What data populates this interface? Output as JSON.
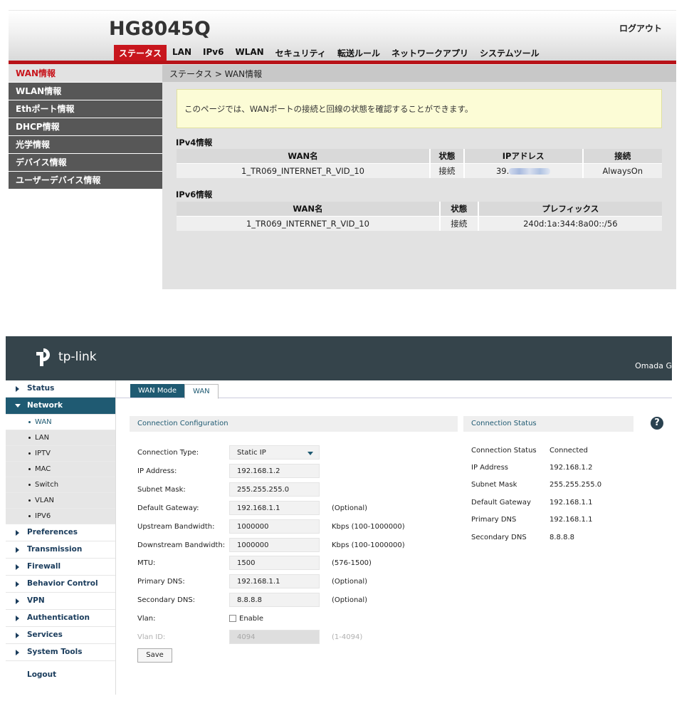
{
  "hg": {
    "model": "HG8045Q",
    "logout": "ログアウト",
    "tabs": [
      "ステータス",
      "LAN",
      "IPv6",
      "WLAN",
      "セキュリティ",
      "転送ルール",
      "ネットワークアプリ",
      "システムツール"
    ],
    "sidebar": [
      "WAN情報",
      "WLAN情報",
      "Ethポート情報",
      "DHCP情報",
      "光学情報",
      "デバイス情報",
      "ユーザーデバイス情報"
    ],
    "breadcrumb": "ステータス > WAN情報",
    "info": "このページでは、WANポートの接続と回線の状態を確認することができます。",
    "ipv4_title": "IPv4情報",
    "ipv4_headers": [
      "WAN名",
      "状態",
      "IPアドレス",
      "接続"
    ],
    "ipv4_row": {
      "wan": "1_TR069_INTERNET_R_VID_10",
      "status": "接続",
      "ip": "39.",
      "conn": "AlwaysOn"
    },
    "ipv6_title": "IPv6情報",
    "ipv6_headers": [
      "WAN名",
      "状態",
      "プレフィックス"
    ],
    "ipv6_row": {
      "wan": "1_TR069_INTERNET_R_VID_10",
      "status": "接続",
      "prefix": "240d:1a:344:8a00::/56"
    }
  },
  "tp": {
    "brand": "tp-link",
    "omada": "Omada G",
    "menu": [
      {
        "label": "Status"
      },
      {
        "label": "Network"
      },
      {
        "label": "Preferences"
      },
      {
        "label": "Transmission"
      },
      {
        "label": "Firewall"
      },
      {
        "label": "Behavior Control"
      },
      {
        "label": "VPN"
      },
      {
        "label": "Authentication"
      },
      {
        "label": "Services"
      },
      {
        "label": "System Tools"
      }
    ],
    "submenu": [
      "WAN",
      "LAN",
      "IPTV",
      "MAC",
      "Switch",
      "VLAN",
      "IPV6"
    ],
    "logout": "Logout",
    "tabs": [
      "WAN Mode",
      "WAN"
    ],
    "config_title": "Connection Configuration",
    "status_title": "Connection Status",
    "help": "?",
    "fields": {
      "connection_type": {
        "label": "Connection Type:",
        "value": "Static IP"
      },
      "ip": {
        "label": "IP Address:",
        "value": "192.168.1.2"
      },
      "mask": {
        "label": "Subnet Mask:",
        "value": "255.255.255.0"
      },
      "gateway": {
        "label": "Default Gateway:",
        "value": "192.168.1.1",
        "suffix": "(Optional)"
      },
      "up": {
        "label": "Upstream Bandwidth:",
        "value": "1000000",
        "suffix": "Kbps (100-1000000)"
      },
      "down": {
        "label": "Downstream Bandwidth:",
        "value": "1000000",
        "suffix": "Kbps (100-1000000)"
      },
      "mtu": {
        "label": "MTU:",
        "value": "1500",
        "suffix": "(576-1500)"
      },
      "dns1": {
        "label": "Primary DNS:",
        "value": "192.168.1.1",
        "suffix": "(Optional)"
      },
      "dns2": {
        "label": "Secondary DNS:",
        "value": "8.8.8.8",
        "suffix": "(Optional)"
      },
      "vlan": {
        "label": "Vlan:",
        "checkbox": "Enable"
      },
      "vlan_id": {
        "label": "Vlan ID:",
        "value": "4094",
        "suffix": "(1-4094)"
      }
    },
    "save": "Save",
    "status": [
      {
        "k": "Connection Status",
        "v": "Connected"
      },
      {
        "k": "IP Address",
        "v": "192.168.1.2"
      },
      {
        "k": "Subnet Mask",
        "v": "255.255.255.0"
      },
      {
        "k": "Default Gateway",
        "v": "192.168.1.1"
      },
      {
        "k": "Primary DNS",
        "v": "192.168.1.1"
      },
      {
        "k": "Secondary DNS",
        "v": "8.8.8.8"
      }
    ]
  }
}
